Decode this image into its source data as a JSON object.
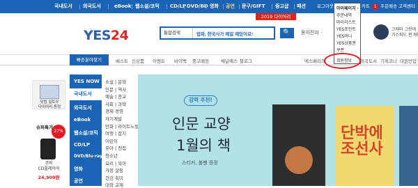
{
  "topnav": [
    "국내도서",
    "외국도서",
    "eBook",
    "웹소설/코믹",
    "CD/LP",
    "DVD/BD",
    "영화",
    "공연",
    "문구/GIFT",
    "중고샵",
    "패션"
  ],
  "util": {
    "login": "로그아웃",
    "cart": "카트",
    "cart_count": "1",
    "order": "주문배송",
    "service": "고객센터"
  },
  "promo": "2019 다이어리",
  "logo": {
    "a": "YES",
    "b": "24",
    ".com": ".COM"
  },
  "search": {
    "category": "통합검색",
    "query": "업파, 한국사가 제일 재밌어요!",
    "button": "🔍"
  },
  "deep_search": "동아전과 ·",
  "ad": {
    "line1": "크레마 그랑데",
    "line2": "가스파드 펀 에디"
  },
  "quick_btn": "빠른분야찾기",
  "menu2": [
    "베스트",
    "신상품",
    "이벤트",
    "바이백",
    "중고매장",
    "채널예스",
    "블로그"
  ],
  "menu2_right": [
    "에스베리즈",
    "외국도서",
    "기획코너",
    "대원반입"
  ],
  "dropdown": [
    "마이페이지 ·",
    "주문내역",
    "마이리스트",
    "YES포인트",
    "YES머니",
    "YES상품권",
    "쿠폰",
    "회원정보"
  ],
  "leftad1": "닷컴 일토우\n다이어리 증정",
  "leftad2": {
    "title": "슈퍼특가",
    "pct": "27%",
    "name": "코비\nCD플레이어",
    "price": "24,900원"
  },
  "sidenav": [
    "YES NOW",
    "국내도서",
    "외국도서",
    "eBook",
    "웹소설/코믹",
    "CD/LP",
    "DVD/Blu-ray",
    "영화",
    "공연"
  ],
  "subcats": [
    "소설 | 문학",
    "인문 | 역사",
    "예술 | 종교",
    "사회 | 과학",
    "경제 경영",
    "자기계발",
    "만화 | 라이트노벨",
    "여행 | 잡지",
    "어린이",
    "유아 | 전집",
    "청소년",
    "요리 | 육아",
    "가정 살림",
    "건강 취미",
    "대학 교재"
  ],
  "banner": {
    "badge": "강력 추천!",
    "title1": "인문 교양",
    "title2": "1월의 책",
    "sub": "스티커, 볼펜 증정",
    "book2_title": "단박에\n조선사"
  }
}
